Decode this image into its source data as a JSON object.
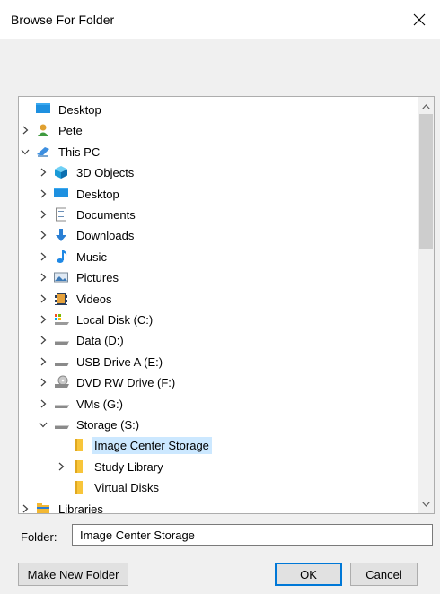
{
  "window": {
    "title": "Browse For Folder"
  },
  "tree": {
    "items": [
      {
        "label": "Desktop",
        "icon": "desktop-icon",
        "expander": "none",
        "selected": false
      },
      {
        "label": "Pete",
        "icon": "user-icon",
        "expander": "collapsed",
        "selected": false
      },
      {
        "label": "This PC",
        "icon": "computer-icon",
        "expander": "expanded",
        "selected": false
      },
      {
        "label": "3D Objects",
        "icon": "3d-objects-icon",
        "expander": "collapsed",
        "selected": false
      },
      {
        "label": "Desktop",
        "icon": "desktop-icon",
        "expander": "collapsed",
        "selected": false
      },
      {
        "label": "Documents",
        "icon": "documents-icon",
        "expander": "collapsed",
        "selected": false
      },
      {
        "label": "Downloads",
        "icon": "download-icon",
        "expander": "collapsed",
        "selected": false
      },
      {
        "label": "Music",
        "icon": "music-icon",
        "expander": "collapsed",
        "selected": false
      },
      {
        "label": "Pictures",
        "icon": "pictures-icon",
        "expander": "collapsed",
        "selected": false
      },
      {
        "label": "Videos",
        "icon": "videos-icon",
        "expander": "collapsed",
        "selected": false
      },
      {
        "label": "Local Disk (C:)",
        "icon": "system-drive-icon",
        "expander": "collapsed",
        "selected": false
      },
      {
        "label": "Data (D:)",
        "icon": "drive-icon",
        "expander": "collapsed",
        "selected": false
      },
      {
        "label": "USB Drive A (E:)",
        "icon": "drive-icon",
        "expander": "collapsed",
        "selected": false
      },
      {
        "label": "DVD RW Drive (F:)",
        "icon": "dvd-drive-icon",
        "expander": "collapsed",
        "selected": false
      },
      {
        "label": "VMs (G:)",
        "icon": "drive-icon",
        "expander": "collapsed",
        "selected": false
      },
      {
        "label": "Storage (S:)",
        "icon": "drive-icon",
        "expander": "expanded",
        "selected": false
      },
      {
        "label": "Image Center Storage",
        "icon": "folder-icon",
        "expander": "none",
        "selected": true
      },
      {
        "label": "Study Library",
        "icon": "folder-icon",
        "expander": "collapsed",
        "selected": false
      },
      {
        "label": "Virtual Disks",
        "icon": "folder-icon",
        "expander": "none",
        "selected": false
      },
      {
        "label": "Libraries",
        "icon": "libraries-icon",
        "expander": "collapsed",
        "selected": false
      }
    ]
  },
  "folder": {
    "label": "Folder:",
    "value": "Image Center Storage"
  },
  "buttons": {
    "make_new_folder": "Make New Folder",
    "ok": "OK",
    "cancel": "Cancel"
  },
  "colors": {
    "selection": "#cce8ff",
    "folder_yellow": "#f8c53a",
    "accent": "#0078d7"
  }
}
